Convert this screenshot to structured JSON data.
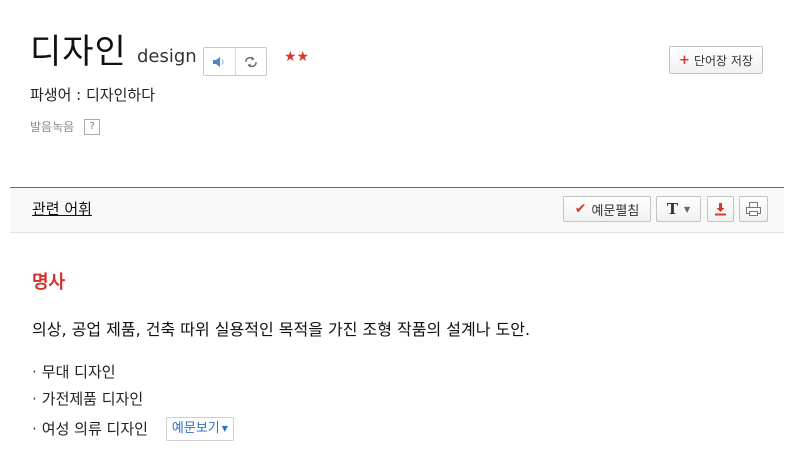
{
  "entry": {
    "headword": "디자인",
    "romanized": "design",
    "stars": "★★",
    "save_label": "단어장 저장",
    "save_plus": "+",
    "derivative": "파생어 : 디자인하다",
    "pronounce_label": "발음녹음",
    "help_label": "?"
  },
  "toolbar": {
    "section_title": "관련 어휘",
    "examples_label": "예문펼침",
    "text_size_label": "T"
  },
  "sense": {
    "part_of_speech": "명사",
    "definition": "의상, 공업 제품, 건축 따위 실용적인 목적을 가진 조형 작품의 설계나 도안.",
    "bullet": "·",
    "examples": [
      "무대 디자인",
      "가전제품 디자인",
      "여성 의류 디자인"
    ],
    "more_examples_label": "예문보기"
  },
  "colors": {
    "accent_red": "#d0332a",
    "link_blue": "#2c6fc7"
  }
}
